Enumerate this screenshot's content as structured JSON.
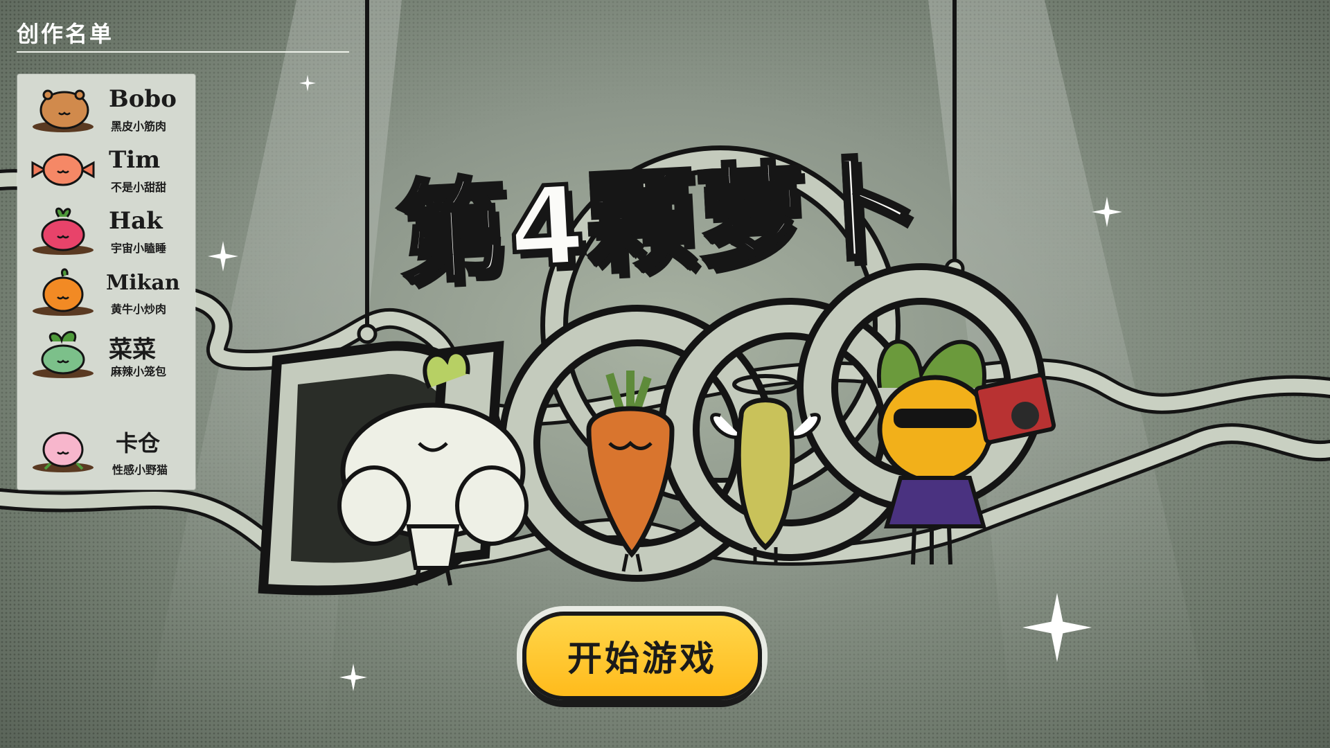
{
  "credits": {
    "title": "创作名单",
    "members": [
      {
        "name": "Bobo",
        "desc": "黑皮小筋肉",
        "avatar": "capybara-icon"
      },
      {
        "name": "Tim",
        "desc": "不是小甜甜",
        "avatar": "candy-icon"
      },
      {
        "name": "Hak",
        "desc": "宇宙小瞌睡",
        "avatar": "radish-icon"
      },
      {
        "name": "Mikan",
        "desc": "黄牛小炒肉",
        "avatar": "orange-icon"
      },
      {
        "name": "菜菜",
        "desc": "麻辣小笼包",
        "avatar": "vegetable-icon"
      },
      {
        "name": "卡仓",
        "desc": "性感小野猫",
        "avatar": "peach-icon"
      }
    ]
  },
  "game": {
    "title": "第4颗萝卜",
    "start_button": "开始游戏"
  },
  "characters": [
    {
      "name": "muscle-daikon-character",
      "color": "#eef0e6"
    },
    {
      "name": "carrot-character",
      "color": "#d9752e"
    },
    {
      "name": "angel-radish-character",
      "color": "#c9c25a"
    },
    {
      "name": "pineapple-boombox-character",
      "color": "#f2b01a"
    }
  ],
  "colors": {
    "accent": "#ffbf24",
    "panel": "#d4d9d0",
    "stage": "#8c968a"
  }
}
